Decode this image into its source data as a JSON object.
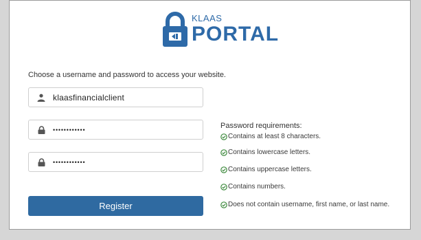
{
  "logo": {
    "small": "KLAAS",
    "big": "PORTAL"
  },
  "intro_text": "Choose a username and password to access your website.",
  "username": {
    "value": "klaasfinancialclient"
  },
  "password": {
    "value": "••••••••••••"
  },
  "confirm_password": {
    "value": "••••••••••••"
  },
  "register_label": "Register",
  "requirements": {
    "title": "Password requirements:",
    "items": [
      "Contains at least 8 characters.",
      "Contains lowercase letters.",
      "Contains uppercase letters.",
      "Contains numbers.",
      "Does not contain username, first name, or last name."
    ]
  },
  "colors": {
    "brand": "#2e6aa8",
    "button": "#2f6aa1",
    "check": "#3d8a3d"
  },
  "icons": {
    "user": "user-icon",
    "lock": "lock-icon",
    "check": "check-circle-icon"
  }
}
